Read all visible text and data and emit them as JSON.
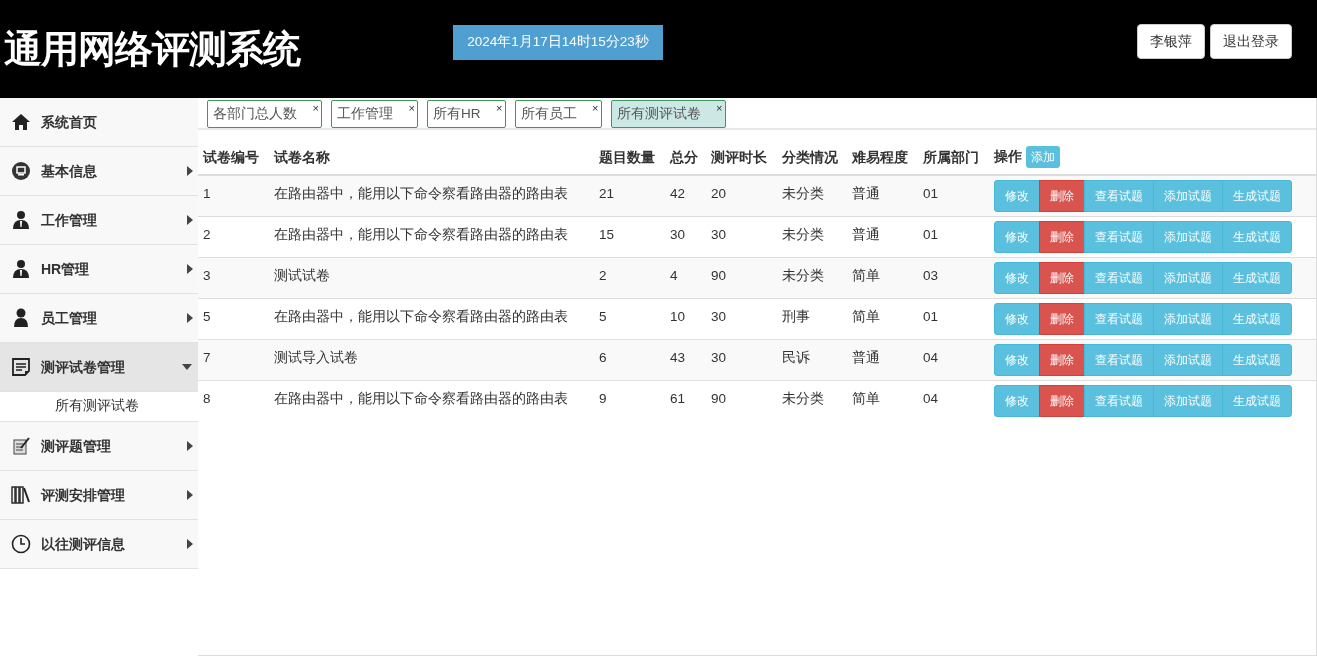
{
  "header": {
    "title": "通用网络评测系统",
    "datetime": "2024年1月17日14时15分23秒",
    "user_button": "李银萍",
    "logout_button": "退出登录"
  },
  "sidebar": {
    "items": [
      {
        "label": "系统首页",
        "expandable": false,
        "selected": false
      },
      {
        "label": "基本信息",
        "expandable": true,
        "expanded": false,
        "selected": false
      },
      {
        "label": "工作管理",
        "expandable": true,
        "expanded": false,
        "selected": false
      },
      {
        "label": "HR管理",
        "expandable": true,
        "expanded": false,
        "selected": false
      },
      {
        "label": "员工管理",
        "expandable": true,
        "expanded": false,
        "selected": false
      },
      {
        "label": "测评试卷管理",
        "expandable": true,
        "expanded": true,
        "selected": true,
        "children": [
          {
            "label": "所有测评试卷"
          }
        ]
      },
      {
        "label": "测评题管理",
        "expandable": true,
        "expanded": false,
        "selected": false
      },
      {
        "label": "评测安排管理",
        "expandable": true,
        "expanded": false,
        "selected": false
      },
      {
        "label": "以往测评信息",
        "expandable": true,
        "expanded": false,
        "selected": false
      }
    ]
  },
  "tabs": [
    {
      "label": "各部门总人数",
      "close": "×",
      "selected": false
    },
    {
      "label": "工作管理",
      "close": "×",
      "selected": false
    },
    {
      "label": "所有HR",
      "close": "×",
      "selected": false
    },
    {
      "label": "所有员工",
      "close": "×",
      "selected": false
    },
    {
      "label": "所有测评试卷",
      "close": "×",
      "selected": true
    }
  ],
  "table": {
    "columns": [
      "试卷编号",
      "试卷名称",
      "题目数量",
      "总分",
      "测评时长",
      "分类情况",
      "难易程度",
      "所属部门",
      "操作"
    ],
    "add_button": "添加",
    "rows": [
      {
        "cells": [
          "1",
          "在路由器中，能用以下命令察看路由器的路由表",
          "21",
          "42",
          "20",
          "未分类",
          "普通",
          "01"
        ],
        "actions": [
          {
            "label": "修改",
            "kind": "info"
          },
          {
            "label": "删除",
            "kind": "danger"
          },
          {
            "label": "查看试题",
            "kind": "info"
          },
          {
            "label": "添加试题",
            "kind": "info"
          },
          {
            "label": "生成试题",
            "kind": "info"
          }
        ]
      },
      {
        "cells": [
          "2",
          "在路由器中，能用以下命令察看路由器的路由表",
          "15",
          "30",
          "30",
          "未分类",
          "普通",
          "01"
        ],
        "actions": [
          {
            "label": "修改",
            "kind": "info"
          },
          {
            "label": "删除",
            "kind": "danger"
          },
          {
            "label": "查看试题",
            "kind": "info"
          },
          {
            "label": "添加试题",
            "kind": "info"
          },
          {
            "label": "生成试题",
            "kind": "info"
          }
        ]
      },
      {
        "cells": [
          "3",
          "测试试卷",
          "2",
          "4",
          "90",
          "未分类",
          "简单",
          "03"
        ],
        "actions": [
          {
            "label": "修改",
            "kind": "info"
          },
          {
            "label": "删除",
            "kind": "danger"
          },
          {
            "label": "查看试题",
            "kind": "info"
          },
          {
            "label": "添加试题",
            "kind": "info"
          },
          {
            "label": "生成试题",
            "kind": "info"
          }
        ]
      },
      {
        "cells": [
          "5",
          "在路由器中，能用以下命令察看路由器的路由表",
          "5",
          "10",
          "30",
          "刑事",
          "简单",
          "01"
        ],
        "actions": [
          {
            "label": "修改",
            "kind": "info"
          },
          {
            "label": "删除",
            "kind": "danger"
          },
          {
            "label": "查看试题",
            "kind": "info"
          },
          {
            "label": "添加试题",
            "kind": "info"
          },
          {
            "label": "生成试题",
            "kind": "info"
          }
        ]
      },
      {
        "cells": [
          "7",
          "测试导入试卷",
          "6",
          "43",
          "30",
          "民诉",
          "普通",
          "04"
        ],
        "actions": [
          {
            "label": "修改",
            "kind": "info"
          },
          {
            "label": "删除",
            "kind": "danger"
          },
          {
            "label": "查看试题",
            "kind": "info"
          },
          {
            "label": "添加试题",
            "kind": "info"
          },
          {
            "label": "生成试题",
            "kind": "info"
          }
        ]
      },
      {
        "cells": [
          "8",
          "在路由器中，能用以下命令察看路由器的路由表",
          "9",
          "61",
          "90",
          "未分类",
          "简单",
          "04"
        ],
        "actions": [
          {
            "label": "修改",
            "kind": "info"
          },
          {
            "label": "删除",
            "kind": "danger"
          },
          {
            "label": "查看试题",
            "kind": "info"
          },
          {
            "label": "添加试题",
            "kind": "info"
          },
          {
            "label": "生成试题",
            "kind": "info"
          }
        ]
      }
    ]
  }
}
